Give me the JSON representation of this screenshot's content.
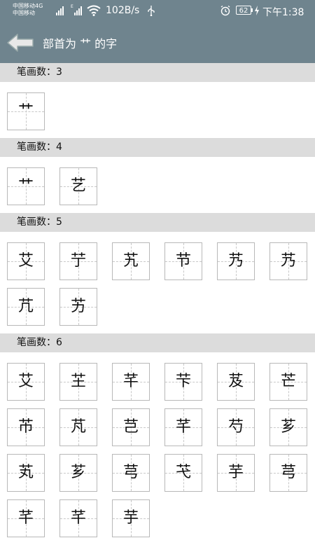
{
  "status_bar": {
    "carrier_1": "中国移动4G",
    "carrier_2": "中国移动",
    "net_label": "E",
    "speed": "102B/s",
    "battery": "62",
    "time": "下午1:38"
  },
  "header": {
    "title": "部首为 艹 的字"
  },
  "sections": [
    {
      "label": "笔画数：3",
      "chars": [
        "艹"
      ]
    },
    {
      "label": "笔画数：4",
      "chars": [
        "艹",
        "艺"
      ]
    },
    {
      "label": "笔画数：5",
      "chars": [
        "艾",
        "艼",
        "艽",
        "节",
        "艿",
        "艿",
        "芁",
        "艻"
      ]
    },
    {
      "label": "笔画数：6",
      "chars": [
        "艾",
        "芏",
        "芊",
        "芐",
        "芨",
        "芒",
        "芇",
        "芃",
        "芑",
        "芊",
        "芍",
        "芗",
        "芄",
        "芗",
        "芎",
        "芅",
        "芋",
        "芎",
        "芊",
        "芊",
        "芋"
      ]
    }
  ]
}
